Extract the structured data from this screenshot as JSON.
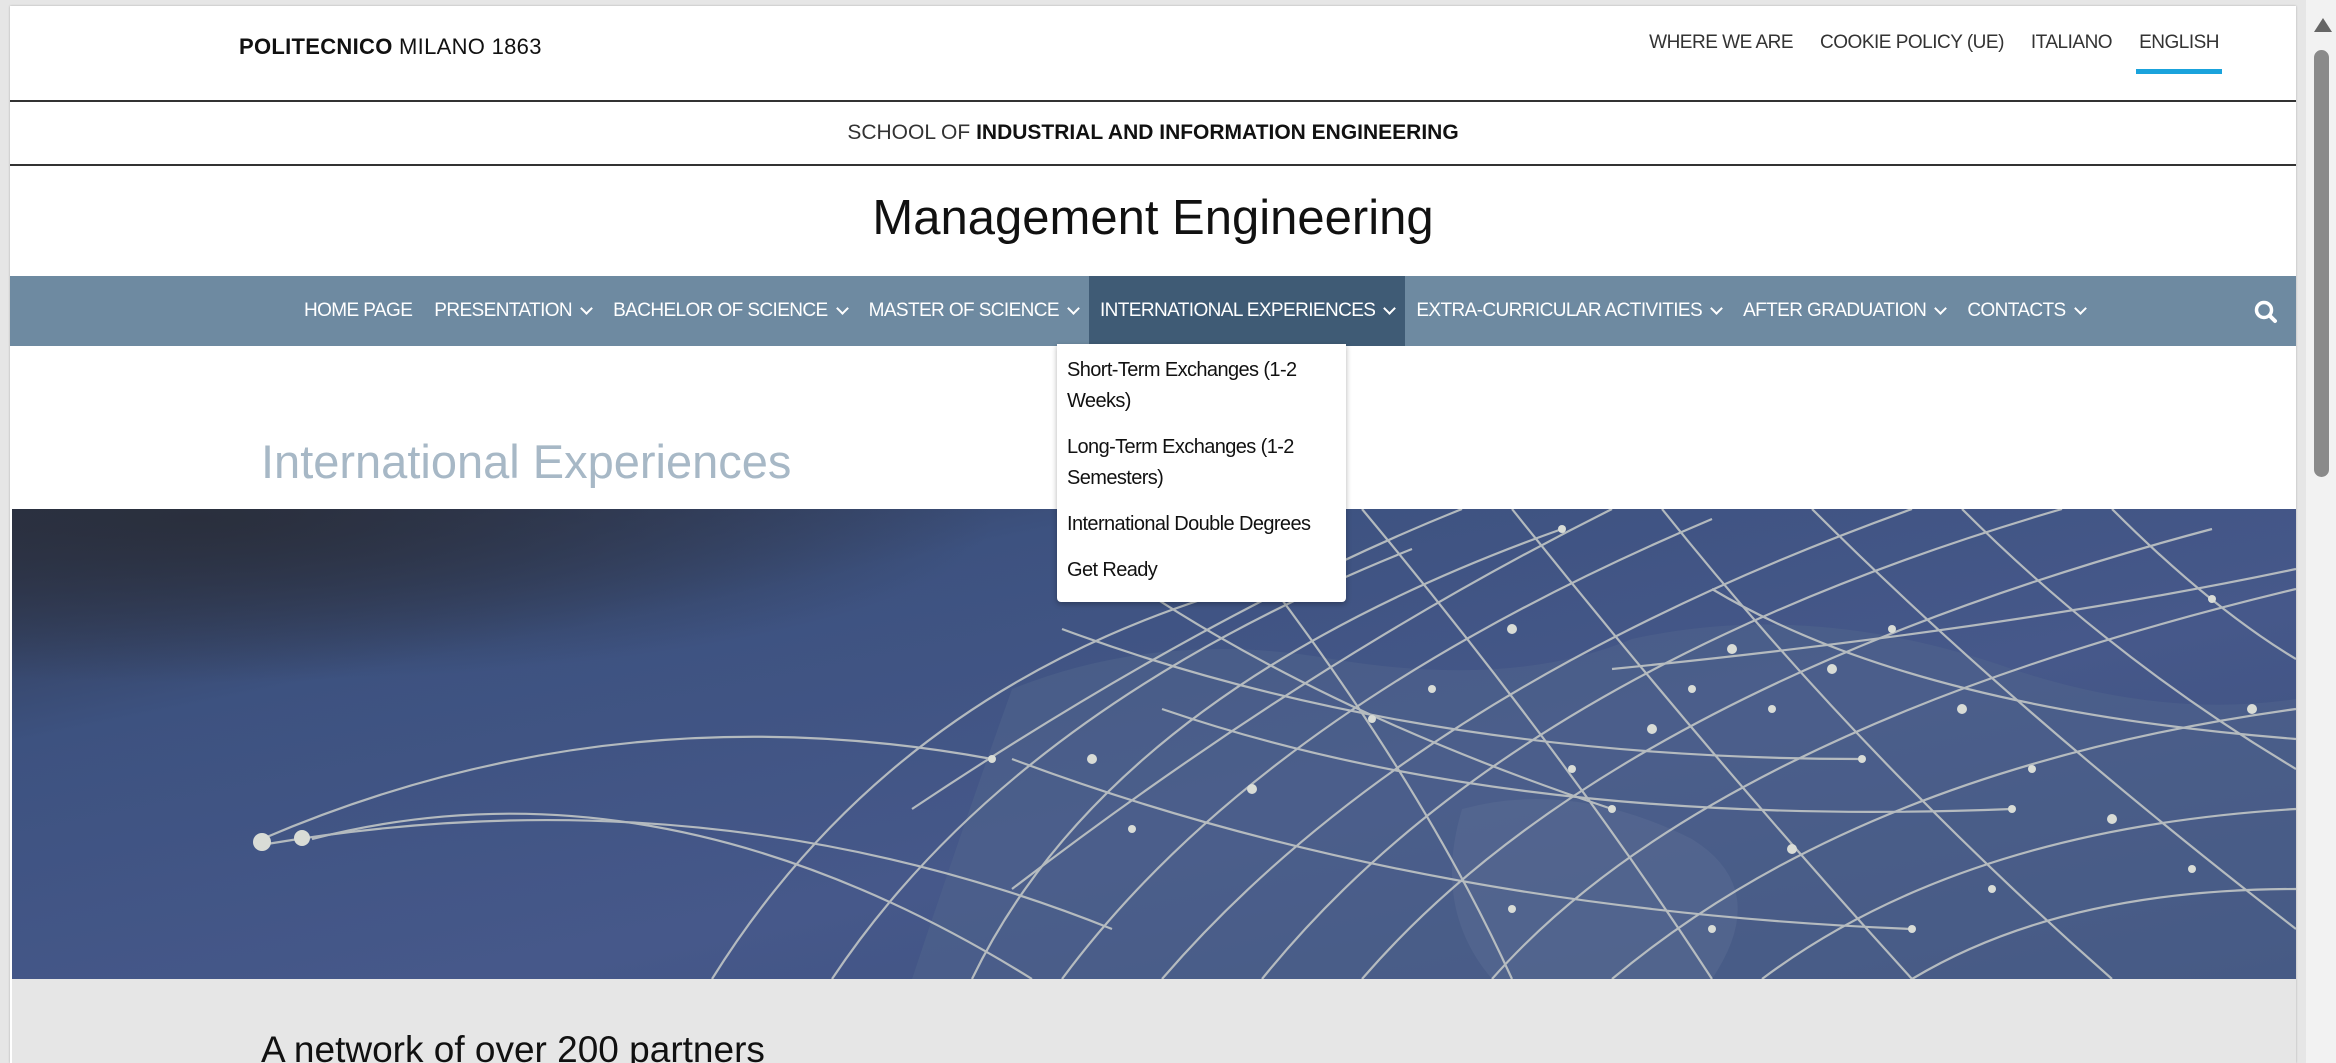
{
  "header": {
    "brand_bold": "POLITECNICO",
    "brand_rest": " MILANO 1863",
    "utility_links": [
      "WHERE WE ARE",
      "COOKIE POLICY (UE)",
      "ITALIANO",
      "ENGLISH"
    ],
    "active_language": "ENGLISH"
  },
  "school": {
    "prefix": "SCHOOL OF ",
    "name": "INDUSTRIAL AND INFORMATION ENGINEERING"
  },
  "site_title": "Management Engineering",
  "main_nav": {
    "items": [
      {
        "label": "HOME PAGE",
        "dropdown": false
      },
      {
        "label": "PRESENTATION",
        "dropdown": true
      },
      {
        "label": "BACHELOR OF SCIENCE",
        "dropdown": true
      },
      {
        "label": "MASTER OF SCIENCE",
        "dropdown": true
      },
      {
        "label": "INTERNATIONAL EXPERIENCES",
        "dropdown": true,
        "active": true
      },
      {
        "label": "EXTRA-CURRICULAR ACTIVITIES",
        "dropdown": true
      },
      {
        "label": "AFTER GRADUATION",
        "dropdown": true
      },
      {
        "label": "CONTACTS",
        "dropdown": true
      }
    ],
    "search_icon": "search-icon"
  },
  "dropdown": {
    "items": [
      "Short-Term Exchanges (1-2 Weeks)",
      "Long-Term Exchanges (1-2 Semesters)",
      "International Double Degrees",
      "Get Ready"
    ]
  },
  "page": {
    "heading": "International Experiences",
    "section_title": "A network of over 200 partners"
  },
  "colors": {
    "nav_bg": "#6e8aa1",
    "nav_active": "#3f5b75",
    "accent_underline": "#1aa3dc",
    "heading": "#a7b8c6",
    "hero_bg": "#3c4f73"
  }
}
